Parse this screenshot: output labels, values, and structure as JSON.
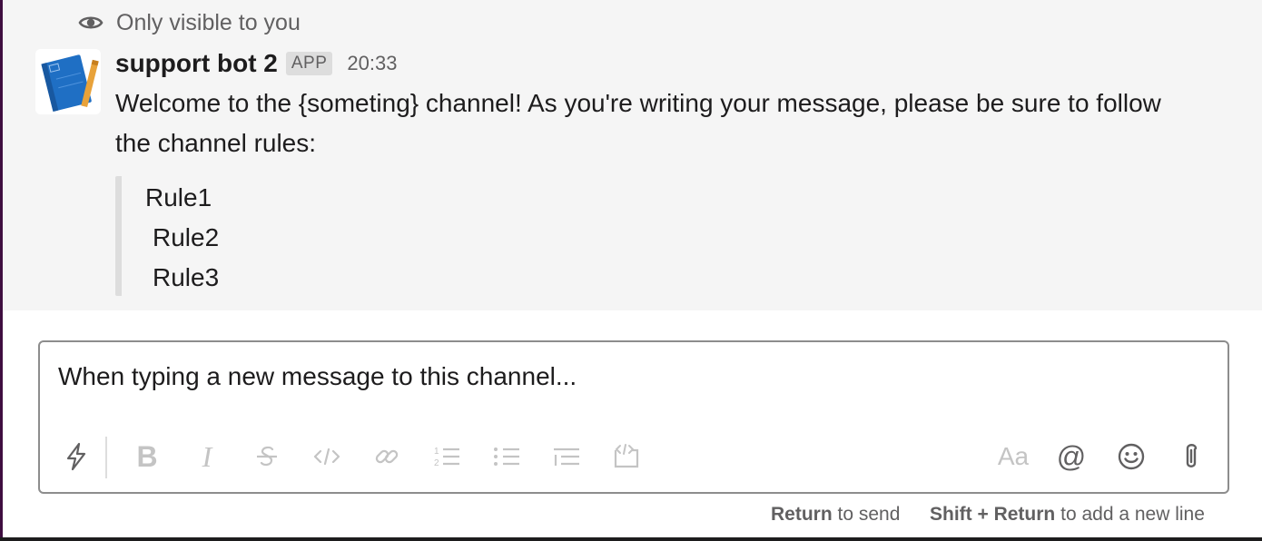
{
  "ephemeral_notice": {
    "icon": "eye-icon",
    "text": "Only visible to you"
  },
  "message": {
    "avatar_icon": "blueprint-notebook-icon",
    "sender": "support bot 2",
    "badge": "APP",
    "timestamp": "20:33",
    "text": "Welcome to the {someting} channel! As you're writing your message, please be sure to follow the channel rules:",
    "quote_lines": [
      "Rule1",
      "Rule2",
      "Rule3"
    ]
  },
  "composer": {
    "value": "When typing a new message to this channel...",
    "toolbar": {
      "shortcuts": "lightning-icon",
      "bold": "B",
      "italic": "I",
      "strikethrough": "strikethrough-icon",
      "code": "code-icon",
      "link": "link-icon",
      "ordered_list": "ordered-list-icon",
      "bulleted_list": "bulleted-list-icon",
      "blockquote": "blockquote-icon",
      "code_block": "code-block-icon",
      "formatting": "Aa",
      "mention": "@",
      "emoji": "emoji-icon",
      "attach": "paperclip-icon"
    }
  },
  "hints": {
    "send_key": "Return",
    "send_text": "to send",
    "newline_key": "Shift + Return",
    "newline_text": "to add a new line"
  },
  "colors": {
    "sidebar_edge": "#3f0e40",
    "message_bg": "#f5f5f5",
    "text": "#1d1c1d",
    "muted": "#616061",
    "avatar_blue": "#1f6fc4",
    "pencil_orange": "#e8a23a"
  }
}
